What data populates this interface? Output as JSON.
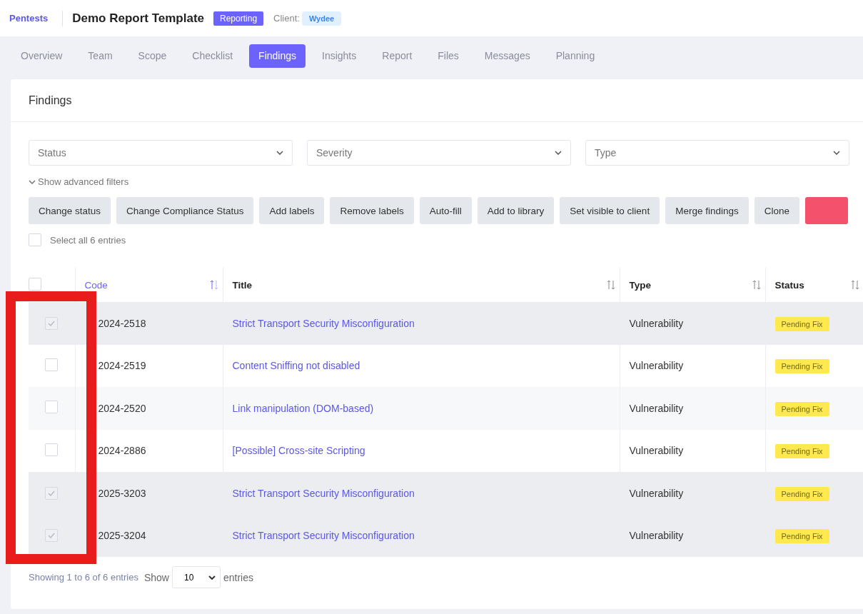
{
  "header": {
    "breadcrumb": "Pentests",
    "title": "Demo Report Template",
    "phase_badge": "Reporting",
    "client_label": "Client:",
    "client_badge": "Wydee"
  },
  "tabs": [
    {
      "label": "Overview",
      "selected": false
    },
    {
      "label": "Team",
      "selected": false
    },
    {
      "label": "Scope",
      "selected": false
    },
    {
      "label": "Checklist",
      "selected": false
    },
    {
      "label": "Findings",
      "selected": true
    },
    {
      "label": "Insights",
      "selected": false
    },
    {
      "label": "Report",
      "selected": false
    },
    {
      "label": "Files",
      "selected": false
    },
    {
      "label": "Messages",
      "selected": false
    },
    {
      "label": "Planning",
      "selected": false
    }
  ],
  "card": {
    "title": "Findings"
  },
  "filters": [
    {
      "placeholder": "Status"
    },
    {
      "placeholder": "Severity"
    },
    {
      "placeholder": "Type"
    }
  ],
  "advanced_filters": "Show advanced filters",
  "actions": [
    {
      "label": "Change status",
      "kind": "plain"
    },
    {
      "label": "Change Compliance Status",
      "kind": "plain"
    },
    {
      "label": "Add labels",
      "kind": "plain"
    },
    {
      "label": "Remove labels",
      "kind": "plain"
    },
    {
      "label": "Auto-fill",
      "kind": "plain"
    },
    {
      "label": "Add to library",
      "kind": "plain"
    },
    {
      "label": "Set visible to client",
      "kind": "plain"
    },
    {
      "label": "Merge findings",
      "kind": "plain"
    },
    {
      "label": "Clone",
      "kind": "plain"
    },
    {
      "kind": "danger"
    }
  ],
  "select_all": {
    "label": "Select all 6 entries",
    "checked": false
  },
  "table": {
    "header_checked": false,
    "columns": [
      {
        "label": "Code",
        "sorted": true
      },
      {
        "label": "Title",
        "sorted": false
      },
      {
        "label": "Type",
        "sorted": false
      },
      {
        "label": "Status",
        "sorted": false
      }
    ],
    "rows": [
      {
        "selected": true,
        "code": "2024-2518",
        "title": "Strict Transport Security Misconfiguration",
        "type": "Vulnerability",
        "status": "Pending Fix"
      },
      {
        "selected": false,
        "code": "2024-2519",
        "title": "Content Sniffing not disabled",
        "type": "Vulnerability",
        "status": "Pending Fix"
      },
      {
        "selected": false,
        "code": "2024-2520",
        "title": "Link manipulation (DOM-based)",
        "type": "Vulnerability",
        "status": "Pending Fix"
      },
      {
        "selected": false,
        "code": "2024-2886",
        "title": "[Possible] Cross-site Scripting",
        "type": "Vulnerability",
        "status": "Pending Fix"
      },
      {
        "selected": true,
        "code": "2025-3203",
        "title": "Strict Transport Security Misconfiguration",
        "type": "Vulnerability",
        "status": "Pending Fix"
      },
      {
        "selected": true,
        "code": "2025-3204",
        "title": "Strict Transport Security Misconfiguration",
        "type": "Vulnerability",
        "status": "Pending Fix"
      }
    ]
  },
  "footer": {
    "info": "Showing 1 to 6 of 6 entries",
    "show_label": "Show",
    "page_size": "10",
    "entries_label": "entries"
  }
}
